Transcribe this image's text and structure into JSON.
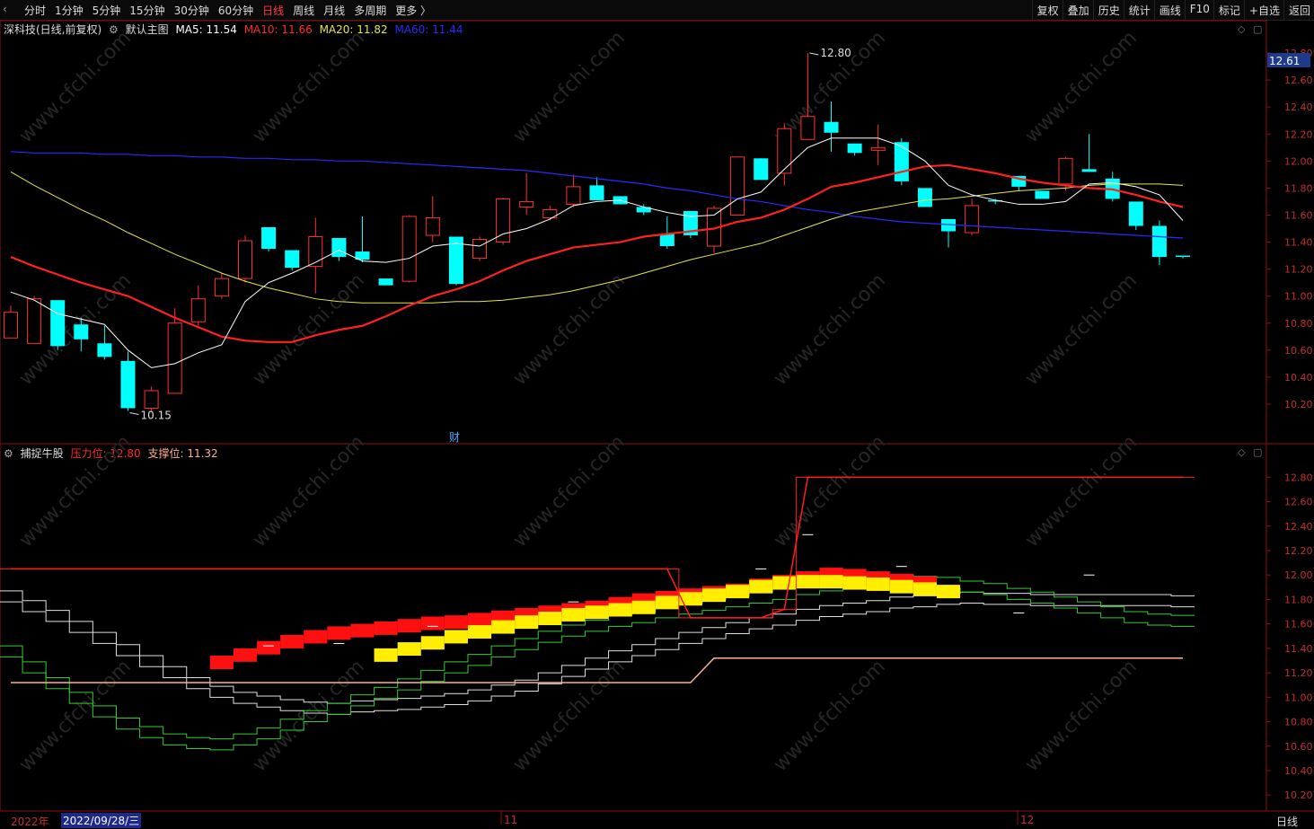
{
  "toolbar": {
    "periods": [
      "分时",
      "1分钟",
      "5分钟",
      "15分钟",
      "30分钟",
      "60分钟",
      "日线",
      "周线",
      "月线",
      "多周期",
      "更多 〉"
    ],
    "active_period": "日线",
    "tools": [
      "复权",
      "叠加",
      "历史",
      "统计",
      "画线",
      "F10",
      "标记",
      "+自选",
      "返回"
    ]
  },
  "main_legend": {
    "stock": "深科技(日线,前复权)",
    "indicator": "默认主图",
    "ma5": "MA5: 11.54",
    "ma10": "MA10: 11.66",
    "ma20": "MA20: 11.82",
    "ma60": "MA60: 11.44"
  },
  "sub_legend": {
    "name": "捕捉牛股",
    "pressure": "压力位: 12.80",
    "support": "支撑位: 11.32"
  },
  "annotations": {
    "high": "12.80",
    "low": "10.15",
    "price_tag": "12.61",
    "finance_marker": "财",
    "watermark": "www.cfchi.com"
  },
  "bottom": {
    "year": "2022年",
    "date": "2022/09/28/三",
    "month1": "11",
    "month2": "12",
    "period_label": "日线"
  },
  "colors": {
    "up": "#ff3030",
    "down": "#00ffff",
    "ma5": "#ffffff",
    "ma10": "#ff2020",
    "ma20": "#e6e64a",
    "ma60": "#2a2aff",
    "pressure": "#ff2020",
    "support": "#ffb090"
  },
  "chart_data": [
    {
      "type": "candlestick",
      "title": "深科技(日线,前复权)",
      "ylim": [
        10.1,
        12.9
      ],
      "y_ticks": [
        12.8,
        12.6,
        12.4,
        12.2,
        12.0,
        11.8,
        11.6,
        11.4,
        11.2,
        11.0,
        10.8,
        10.6,
        10.4,
        10.2
      ],
      "candles": [
        {
          "o": 10.69,
          "h": 10.93,
          "l": 10.69,
          "c": 10.88
        },
        {
          "o": 10.65,
          "h": 11.0,
          "l": 10.65,
          "c": 10.98
        },
        {
          "o": 10.97,
          "h": 10.97,
          "l": 10.6,
          "c": 10.63
        },
        {
          "o": 10.79,
          "h": 10.84,
          "l": 10.59,
          "c": 10.68
        },
        {
          "o": 10.65,
          "h": 10.78,
          "l": 10.53,
          "c": 10.55
        },
        {
          "o": 10.52,
          "h": 10.59,
          "l": 10.15,
          "c": 10.17
        },
        {
          "o": 10.17,
          "h": 10.33,
          "l": 10.15,
          "c": 10.3
        },
        {
          "o": 10.28,
          "h": 10.91,
          "l": 10.28,
          "c": 10.8
        },
        {
          "o": 10.81,
          "h": 11.08,
          "l": 10.78,
          "c": 10.98
        },
        {
          "o": 11.0,
          "h": 11.17,
          "l": 10.98,
          "c": 11.13
        },
        {
          "o": 11.13,
          "h": 11.45,
          "l": 11.1,
          "c": 11.41
        },
        {
          "o": 11.51,
          "h": 11.51,
          "l": 11.33,
          "c": 11.35
        },
        {
          "o": 11.34,
          "h": 11.34,
          "l": 11.19,
          "c": 11.21
        },
        {
          "o": 11.22,
          "h": 11.58,
          "l": 11.02,
          "c": 11.44
        },
        {
          "o": 11.43,
          "h": 11.43,
          "l": 11.26,
          "c": 11.29
        },
        {
          "o": 11.33,
          "h": 11.59,
          "l": 11.25,
          "c": 11.27
        },
        {
          "o": 11.13,
          "h": 11.13,
          "l": 11.08,
          "c": 11.08
        },
        {
          "o": 11.11,
          "h": 11.6,
          "l": 11.1,
          "c": 11.59
        },
        {
          "o": 11.45,
          "h": 11.74,
          "l": 11.4,
          "c": 11.58
        },
        {
          "o": 11.44,
          "h": 11.44,
          "l": 11.08,
          "c": 11.09
        },
        {
          "o": 11.28,
          "h": 11.44,
          "l": 11.26,
          "c": 11.42
        },
        {
          "o": 11.4,
          "h": 11.73,
          "l": 11.38,
          "c": 11.72
        },
        {
          "o": 11.66,
          "h": 11.91,
          "l": 11.6,
          "c": 11.7
        },
        {
          "o": 11.58,
          "h": 11.67,
          "l": 11.56,
          "c": 11.64
        },
        {
          "o": 11.68,
          "h": 11.9,
          "l": 11.66,
          "c": 11.81
        },
        {
          "o": 11.82,
          "h": 11.88,
          "l": 11.71,
          "c": 11.71
        },
        {
          "o": 11.74,
          "h": 11.74,
          "l": 11.68,
          "c": 11.68
        },
        {
          "o": 11.66,
          "h": 11.68,
          "l": 11.6,
          "c": 11.62
        },
        {
          "o": 11.46,
          "h": 11.59,
          "l": 11.35,
          "c": 11.37
        },
        {
          "o": 11.63,
          "h": 11.63,
          "l": 11.43,
          "c": 11.45
        },
        {
          "o": 11.37,
          "h": 11.67,
          "l": 11.32,
          "c": 11.65
        },
        {
          "o": 11.6,
          "h": 12.03,
          "l": 11.6,
          "c": 12.03
        },
        {
          "o": 12.02,
          "h": 12.02,
          "l": 11.87,
          "c": 11.86
        },
        {
          "o": 11.91,
          "h": 12.28,
          "l": 11.82,
          "c": 12.24
        },
        {
          "o": 12.16,
          "h": 12.8,
          "l": 12.16,
          "c": 12.33
        },
        {
          "o": 12.29,
          "h": 12.44,
          "l": 12.07,
          "c": 12.21
        },
        {
          "o": 12.13,
          "h": 12.13,
          "l": 12.04,
          "c": 12.06
        },
        {
          "o": 12.08,
          "h": 12.27,
          "l": 11.97,
          "c": 12.1
        },
        {
          "o": 12.14,
          "h": 12.17,
          "l": 11.82,
          "c": 11.85
        },
        {
          "o": 11.8,
          "h": 11.8,
          "l": 11.67,
          "c": 11.66
        },
        {
          "o": 11.57,
          "h": 11.57,
          "l": 11.36,
          "c": 11.48
        },
        {
          "o": 11.47,
          "h": 11.72,
          "l": 11.45,
          "c": 11.67
        },
        {
          "o": 11.71,
          "h": 11.72,
          "l": 11.68,
          "c": 11.7
        },
        {
          "o": 11.89,
          "h": 11.89,
          "l": 11.78,
          "c": 11.81
        },
        {
          "o": 11.78,
          "h": 11.78,
          "l": 11.72,
          "c": 11.72
        },
        {
          "o": 11.83,
          "h": 12.03,
          "l": 11.78,
          "c": 12.02
        },
        {
          "o": 11.94,
          "h": 12.2,
          "l": 11.92,
          "c": 11.92
        },
        {
          "o": 11.87,
          "h": 11.92,
          "l": 11.7,
          "c": 11.72
        },
        {
          "o": 11.7,
          "h": 11.7,
          "l": 11.49,
          "c": 11.52
        },
        {
          "o": 11.52,
          "h": 11.56,
          "l": 11.23,
          "c": 11.29
        },
        {
          "o": 11.3,
          "h": 11.3,
          "l": 11.28,
          "c": 11.29
        }
      ],
      "ma5": [
        11.03,
        10.97,
        10.87,
        10.83,
        10.79,
        10.6,
        10.47,
        10.5,
        10.58,
        10.64,
        10.96,
        11.1,
        11.17,
        11.25,
        11.34,
        11.26,
        11.25,
        11.28,
        11.37,
        11.39,
        11.37,
        11.46,
        11.5,
        11.57,
        11.67,
        11.7,
        11.71,
        11.66,
        11.62,
        11.59,
        11.6,
        11.72,
        11.77,
        11.94,
        12.1,
        12.17,
        12.17,
        12.17,
        12.11,
        12.0,
        11.82,
        11.75,
        11.71,
        11.68,
        11.68,
        11.7,
        11.83,
        11.84,
        11.81,
        11.75,
        11.56
      ],
      "ma10": [
        11.29,
        11.22,
        11.16,
        11.1,
        11.05,
        11.0,
        10.92,
        10.84,
        10.77,
        10.7,
        10.67,
        10.66,
        10.66,
        10.71,
        10.75,
        10.78,
        10.85,
        10.93,
        11.0,
        11.05,
        11.11,
        11.19,
        11.26,
        11.31,
        11.36,
        11.38,
        11.4,
        11.44,
        11.46,
        11.48,
        11.5,
        11.55,
        11.58,
        11.64,
        11.72,
        11.81,
        11.84,
        11.88,
        11.92,
        11.96,
        11.97,
        11.94,
        11.91,
        11.87,
        11.84,
        11.82,
        11.8,
        11.79,
        11.75,
        11.7,
        11.66
      ],
      "ma20": [
        11.92,
        11.82,
        11.73,
        11.64,
        11.56,
        11.47,
        11.39,
        11.31,
        11.24,
        11.17,
        11.11,
        11.06,
        11.02,
        10.98,
        10.96,
        10.95,
        10.95,
        10.95,
        10.95,
        10.96,
        10.96,
        10.97,
        10.99,
        11.01,
        11.04,
        11.08,
        11.12,
        11.17,
        11.22,
        11.27,
        11.31,
        11.35,
        11.39,
        11.45,
        11.51,
        11.57,
        11.62,
        11.65,
        11.68,
        11.71,
        11.72,
        11.74,
        11.76,
        11.78,
        11.79,
        11.8,
        11.82,
        11.83,
        11.83,
        11.83,
        11.82
      ],
      "ma60": [
        12.07,
        12.06,
        12.06,
        12.06,
        12.05,
        12.05,
        12.04,
        12.04,
        12.03,
        12.03,
        12.02,
        12.02,
        12.01,
        12.01,
        12.0,
        12.0,
        11.99,
        11.98,
        11.97,
        11.96,
        11.95,
        11.94,
        11.93,
        11.91,
        11.89,
        11.87,
        11.85,
        11.83,
        11.8,
        11.78,
        11.75,
        11.72,
        11.7,
        11.67,
        11.64,
        11.62,
        11.59,
        11.57,
        11.55,
        11.54,
        11.53,
        11.52,
        11.51,
        11.5,
        11.49,
        11.48,
        11.47,
        11.46,
        11.45,
        11.44,
        11.43
      ]
    },
    {
      "type": "line",
      "title": "捕捉牛股",
      "ylim": [
        10.15,
        12.92
      ],
      "y_ticks": [
        12.8,
        12.6,
        12.4,
        12.2,
        12.0,
        11.8,
        11.6,
        11.4,
        11.2,
        11.0,
        10.8,
        10.6,
        10.4,
        10.2
      ],
      "series": [
        {
          "name": "压力位",
          "values": [
            12.05,
            12.05,
            12.05,
            12.05,
            12.05,
            12.05,
            12.05,
            12.05,
            12.05,
            12.05,
            12.05,
            12.05,
            12.05,
            12.05,
            12.05,
            12.05,
            12.05,
            12.05,
            12.05,
            12.05,
            12.05,
            12.05,
            12.05,
            12.05,
            12.05,
            12.05,
            12.05,
            12.05,
            12.05,
            11.65,
            11.65,
            11.65,
            11.65,
            11.72,
            12.8,
            12.8,
            12.8,
            12.8,
            12.8,
            12.8,
            12.8,
            12.8,
            12.8,
            12.8,
            12.8,
            12.8,
            12.8,
            12.8,
            12.8,
            12.8,
            12.8
          ]
        },
        {
          "name": "支撑位",
          "values": [
            11.12,
            11.12,
            11.12,
            11.12,
            11.12,
            11.12,
            11.12,
            11.12,
            11.12,
            11.12,
            11.12,
            11.12,
            11.12,
            11.12,
            11.12,
            11.12,
            11.12,
            11.12,
            11.12,
            11.12,
            11.12,
            11.12,
            11.12,
            11.12,
            11.12,
            11.12,
            11.12,
            11.12,
            11.12,
            11.12,
            11.32,
            11.32,
            11.32,
            11.32,
            11.32,
            11.32,
            11.32,
            11.32,
            11.32,
            11.32,
            11.32,
            11.32,
            11.32,
            11.32,
            11.32,
            11.32,
            11.32,
            11.32,
            11.32,
            11.32,
            11.32
          ]
        },
        {
          "name": "band_top",
          "values": [
            10.67,
            10.72,
            10.79,
            10.86,
            10.93,
            11.0,
            11.07,
            11.14,
            11.21,
            11.28,
            11.34,
            11.4,
            11.45,
            11.49,
            11.52,
            11.54,
            11.56,
            11.58,
            11.6,
            11.61,
            11.63,
            11.65,
            11.67,
            11.69,
            11.71,
            11.73,
            11.76,
            11.79,
            11.81,
            11.83,
            11.85,
            11.87,
            11.91,
            11.94,
            11.97,
            12.0,
            11.99,
            11.97,
            11.95,
            11.93,
            11.91,
            11.89,
            11.87,
            11.85,
            11.84,
            11.83,
            11.83,
            11.82,
            11.82,
            11.82,
            11.82
          ]
        },
        {
          "name": "band_bottom",
          "values": [
            10.66,
            10.7,
            10.76,
            10.83,
            10.89,
            10.94,
            10.97,
            10.99,
            11.0,
            11.02,
            11.06,
            11.1,
            11.14,
            11.2,
            11.26,
            11.32,
            11.38,
            11.43,
            11.48,
            11.53,
            11.57,
            11.61,
            11.65,
            11.68,
            11.71,
            11.73,
            11.75,
            11.77,
            11.81,
            11.84,
            11.87,
            11.9,
            11.94,
            11.97,
            11.98,
            11.98,
            11.97,
            11.96,
            11.94,
            11.92,
            11.9,
            11.88,
            11.86,
            11.84,
            11.83,
            11.82,
            11.82,
            11.82,
            11.82,
            11.82,
            11.82
          ]
        },
        {
          "name": "white_steps",
          "values": [
            11.87,
            11.79,
            11.71,
            11.62,
            11.53,
            11.43,
            11.34,
            11.25,
            11.16,
            11.09,
            11.04,
            11.01,
            10.98,
            10.96,
            10.95,
            10.97,
            10.98,
            10.99,
            11.01,
            11.03,
            11.06,
            11.1,
            11.14,
            11.2,
            11.26,
            11.32,
            11.38,
            11.43,
            11.48,
            11.53,
            11.57,
            11.61,
            11.65,
            11.68,
            11.72,
            11.75,
            11.77,
            11.79,
            11.82,
            11.83,
            11.85,
            11.86,
            11.85,
            11.85,
            11.84,
            11.84,
            11.84,
            11.84,
            11.84,
            11.84,
            11.83
          ]
        },
        {
          "name": "green_steps",
          "values": [
            11.42,
            11.29,
            11.16,
            11.04,
            10.93,
            10.83,
            10.76,
            10.7,
            10.67,
            10.66,
            10.7,
            10.75,
            10.82,
            10.89,
            10.95,
            11.02,
            11.08,
            11.15,
            11.22,
            11.29,
            11.35,
            11.42,
            11.48,
            11.54,
            11.59,
            11.63,
            11.67,
            11.7,
            11.74,
            11.77,
            11.8,
            11.83,
            11.86,
            11.89,
            11.93,
            11.96,
            11.98,
            12.0,
            12.0,
            11.99,
            11.98,
            11.95,
            11.93,
            11.89,
            11.86,
            11.82,
            11.78,
            11.74,
            11.7,
            11.68,
            11.67
          ]
        },
        {
          "name": "markers",
          "values": [
            null,
            null,
            null,
            null,
            null,
            null,
            null,
            null,
            null,
            null,
            null,
            11.42,
            null,
            null,
            11.44,
            null,
            null,
            null,
            11.58,
            null,
            null,
            null,
            null,
            null,
            11.78,
            null,
            null,
            null,
            null,
            null,
            null,
            null,
            12.05,
            null,
            12.33,
            null,
            null,
            null,
            12.07,
            null,
            null,
            null,
            null,
            11.69,
            null,
            null,
            12.0,
            null,
            null,
            null,
            null
          ]
        }
      ]
    }
  ]
}
